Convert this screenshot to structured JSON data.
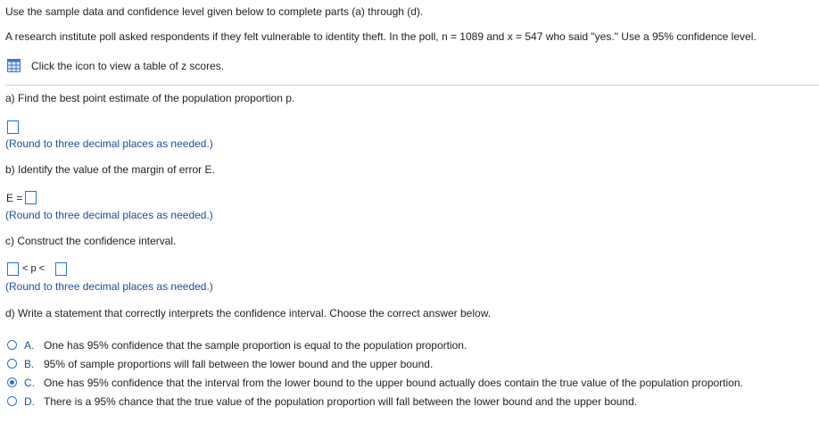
{
  "instructions": "Use the sample data and confidence level given below to complete parts (a) through (d).",
  "problem": "A research institute poll asked respondents if they felt vulnerable to identity theft. In the poll, n = 1089 and x = 547 who said \"yes.\" Use a 95% confidence level.",
  "table_link": "Click the icon to view a table of z scores.",
  "part_a": {
    "prompt": "a) Find the best point estimate of the population proportion p.",
    "note": "(Round to three decimal places as needed.)"
  },
  "part_b": {
    "prompt": "b) Identify the value of the margin of error E.",
    "label": "E =",
    "note": "(Round to three decimal places as needed.)"
  },
  "part_c": {
    "prompt": "c) Construct the confidence interval.",
    "middle": "< p <",
    "note": "(Round to three decimal places as needed.)"
  },
  "part_d": {
    "prompt": "d) Write a statement that correctly interprets the confidence interval. Choose the correct answer below.",
    "selected": "C",
    "options": [
      {
        "letter": "A.",
        "text": "One has 95% confidence that the sample proportion is equal to the population proportion."
      },
      {
        "letter": "B.",
        "text": "95% of sample proportions will fall between the lower bound and the upper bound."
      },
      {
        "letter": "C.",
        "text": "One has 95% confidence that the interval from the lower bound to the upper bound actually does contain the true value of the population proportion."
      },
      {
        "letter": "D.",
        "text": "There is a 95% chance that the true value of the population proportion will fall between the lower bound and the upper bound."
      }
    ]
  },
  "colors": {
    "accent": "#2f6fc3",
    "note_text": "#1d4e8f"
  }
}
